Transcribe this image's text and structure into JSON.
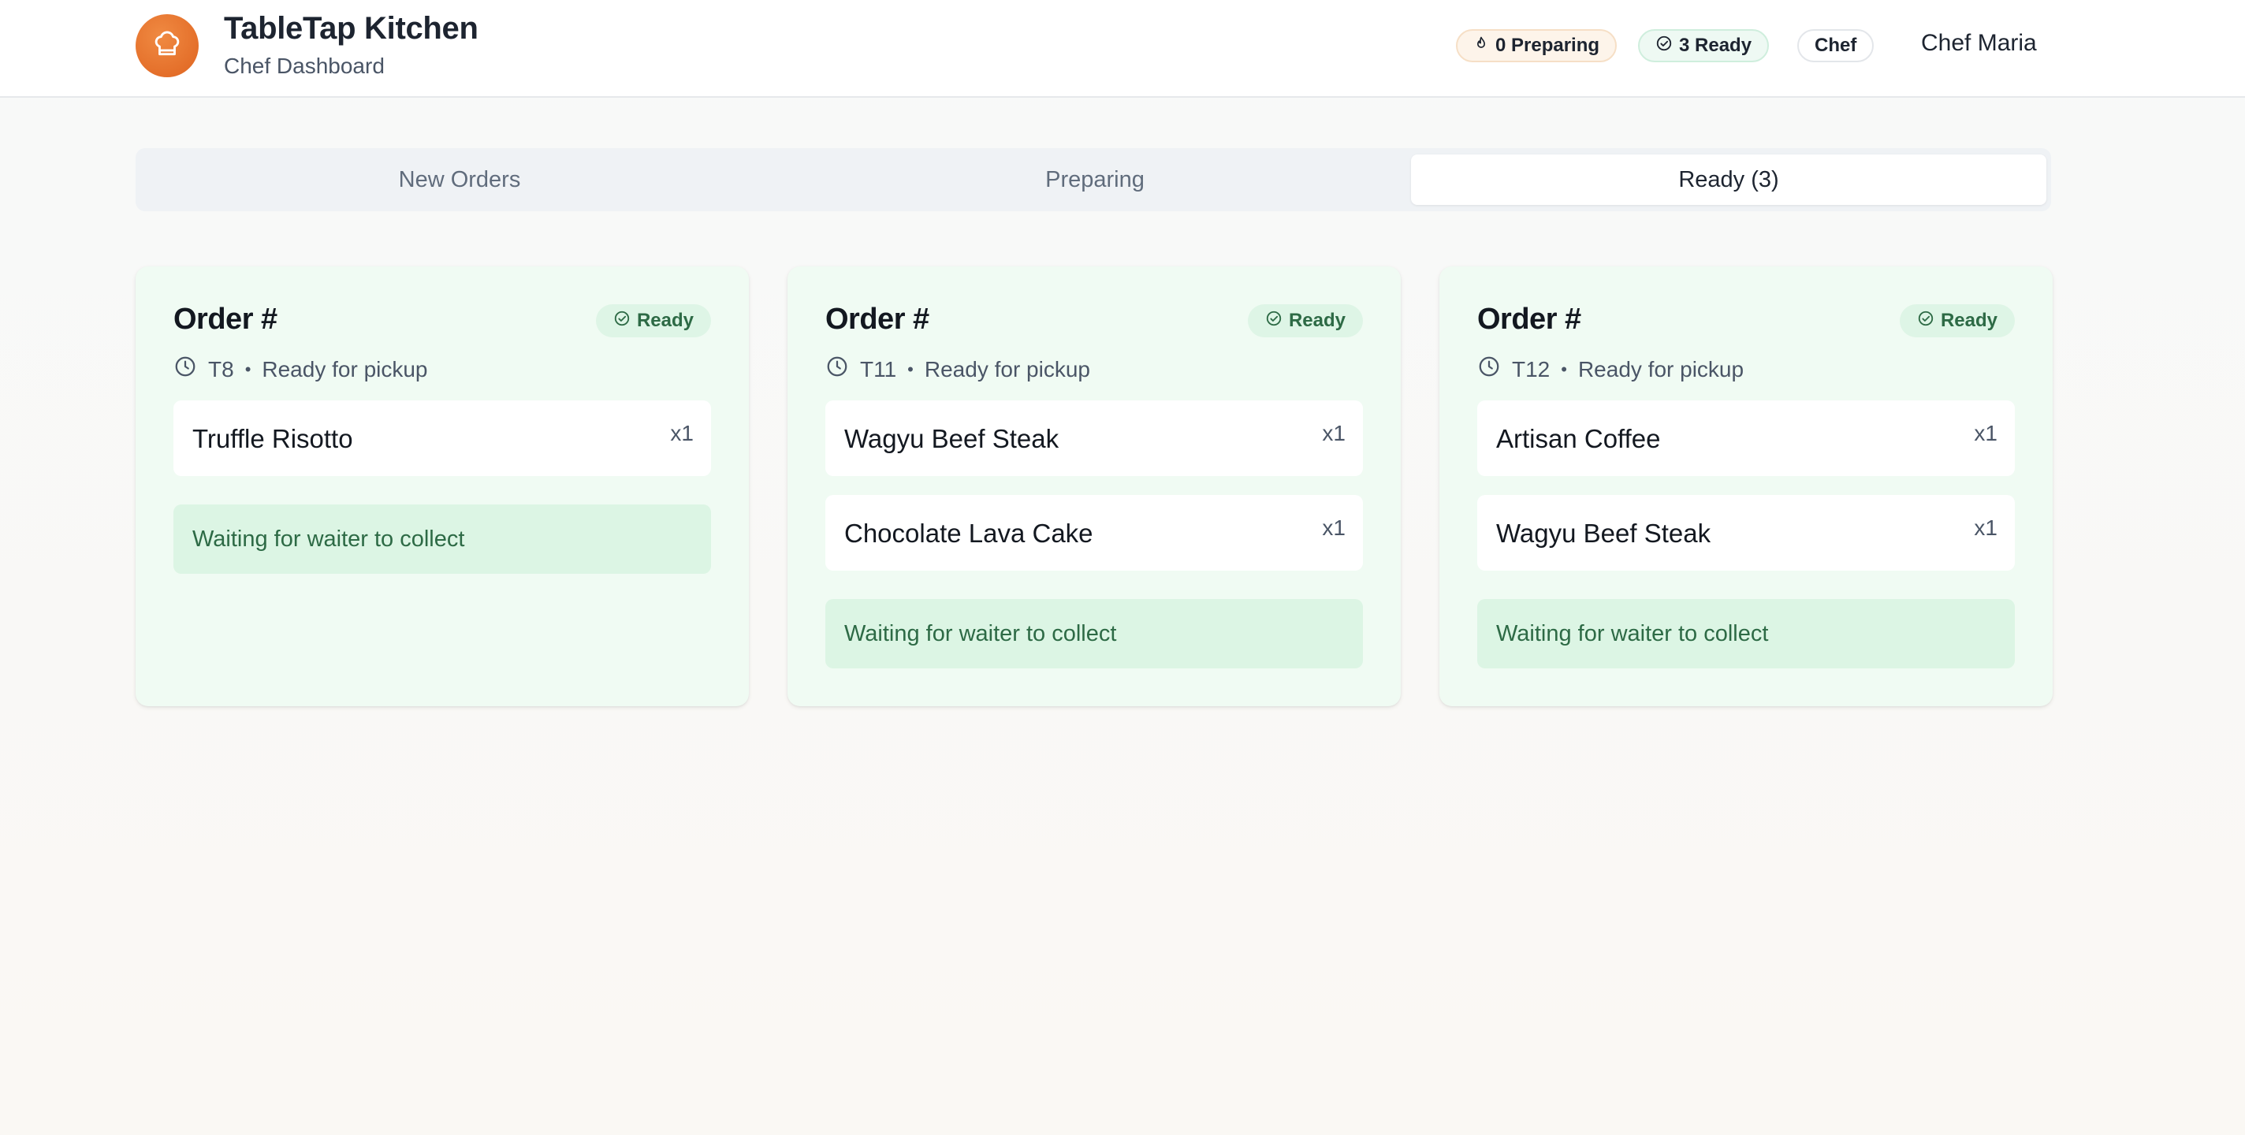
{
  "app": {
    "title": "TableTap Kitchen",
    "subtitle": "Chef Dashboard",
    "logo_icon": "chef-hat-icon",
    "accent_color": "#e46f2a"
  },
  "header": {
    "preparing_pill": "0 Preparing",
    "ready_pill": "3 Ready",
    "role": "Chef",
    "user": "Chef Maria"
  },
  "tabs": [
    {
      "label": "New Orders",
      "active": false
    },
    {
      "label": "Preparing",
      "active": false
    },
    {
      "label": "Ready (3)",
      "active": true
    }
  ],
  "orders": [
    {
      "title": "Order #",
      "status": "Ready",
      "table": "T8",
      "status_text": "Ready for pickup",
      "items": [
        {
          "name": "Truffle Risotto",
          "qty": "x1"
        }
      ],
      "note": "Waiting for waiter to collect"
    },
    {
      "title": "Order #",
      "status": "Ready",
      "table": "T11",
      "status_text": "Ready for pickup",
      "items": [
        {
          "name": "Wagyu Beef Steak",
          "qty": "x1"
        },
        {
          "name": "Chocolate Lava Cake",
          "qty": "x1"
        }
      ],
      "note": "Waiting for waiter to collect"
    },
    {
      "title": "Order #",
      "status": "Ready",
      "table": "T12",
      "status_text": "Ready for pickup",
      "items": [
        {
          "name": "Artisan Coffee",
          "qty": "x1"
        },
        {
          "name": "Wagyu Beef Steak",
          "qty": "x1"
        }
      ],
      "note": "Waiting for waiter to collect"
    }
  ],
  "meta_separator": "•",
  "colors": {
    "ready_green": "#2d6a45",
    "card_bg": "#f0fbf3",
    "badge_bg": "#def5e6"
  }
}
